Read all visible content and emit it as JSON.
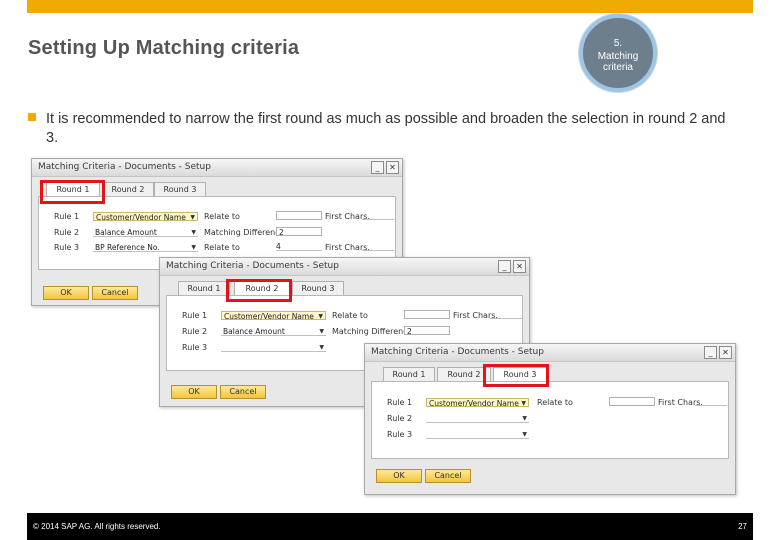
{
  "slide": {
    "title": "Setting Up Matching criteria",
    "badge_number": "5.",
    "badge_label": "Matching criteria",
    "bullet_text": "It is recommended to narrow the first round as much as possible and broaden the selection in round 2 and 3."
  },
  "windows": [
    {
      "title": "Matching Criteria - Documents - Setup",
      "tabs": [
        "Round 1",
        "Round 2",
        "Round 3"
      ],
      "active_tab": "Round 1",
      "rows": [
        {
          "label": "Rule 1",
          "value": "Customer/Vendor Name",
          "extra_label": "Relate to",
          "extra_value": "",
          "chars_label": "First Chars."
        },
        {
          "label": "Rule 2",
          "value": "Balance Amount",
          "extra_label": "Matching Difference",
          "extra_value": "2",
          "chars_label": ""
        },
        {
          "label": "Rule 3",
          "value": "BP Reference No.",
          "extra_label": "Relate to",
          "extra_value": "4",
          "chars_label": "First Chars."
        }
      ],
      "ok_label": "OK",
      "cancel_label": "Cancel"
    },
    {
      "title": "Matching Criteria - Documents - Setup",
      "tabs": [
        "Round 1",
        "Round 2",
        "Round 3"
      ],
      "active_tab": "Round 2",
      "rows": [
        {
          "label": "Rule 1",
          "value": "Customer/Vendor Name",
          "extra_label": "Relate to",
          "extra_value": "",
          "chars_label": "First Chars."
        },
        {
          "label": "Rule 2",
          "value": "Balance Amount",
          "extra_label": "Matching Difference",
          "extra_value": "2",
          "chars_label": ""
        },
        {
          "label": "Rule 3",
          "value": "",
          "extra_label": "",
          "extra_value": "",
          "chars_label": ""
        }
      ],
      "ok_label": "OK",
      "cancel_label": "Cancel"
    },
    {
      "title": "Matching Criteria - Documents - Setup",
      "tabs": [
        "Round 1",
        "Round 2",
        "Round 3"
      ],
      "active_tab": "Round 3",
      "rows": [
        {
          "label": "Rule 1",
          "value": "Customer/Vendor Name",
          "extra_label": "Relate to",
          "extra_value": "",
          "chars_label": "First Chars."
        },
        {
          "label": "Rule 2",
          "value": "",
          "extra_label": "",
          "extra_value": "",
          "chars_label": ""
        },
        {
          "label": "Rule 3",
          "value": "",
          "extra_label": "",
          "extra_value": "",
          "chars_label": ""
        }
      ],
      "ok_label": "OK",
      "cancel_label": "Cancel"
    }
  ],
  "footer": {
    "copyright": "© 2014 SAP AG. All rights reserved.",
    "page_number": "27"
  },
  "colors": {
    "accent": "#f0ab00",
    "highlight": "#e2141a",
    "badge_fill": "#6d7e8c",
    "badge_ring": "#9ec5e4"
  }
}
